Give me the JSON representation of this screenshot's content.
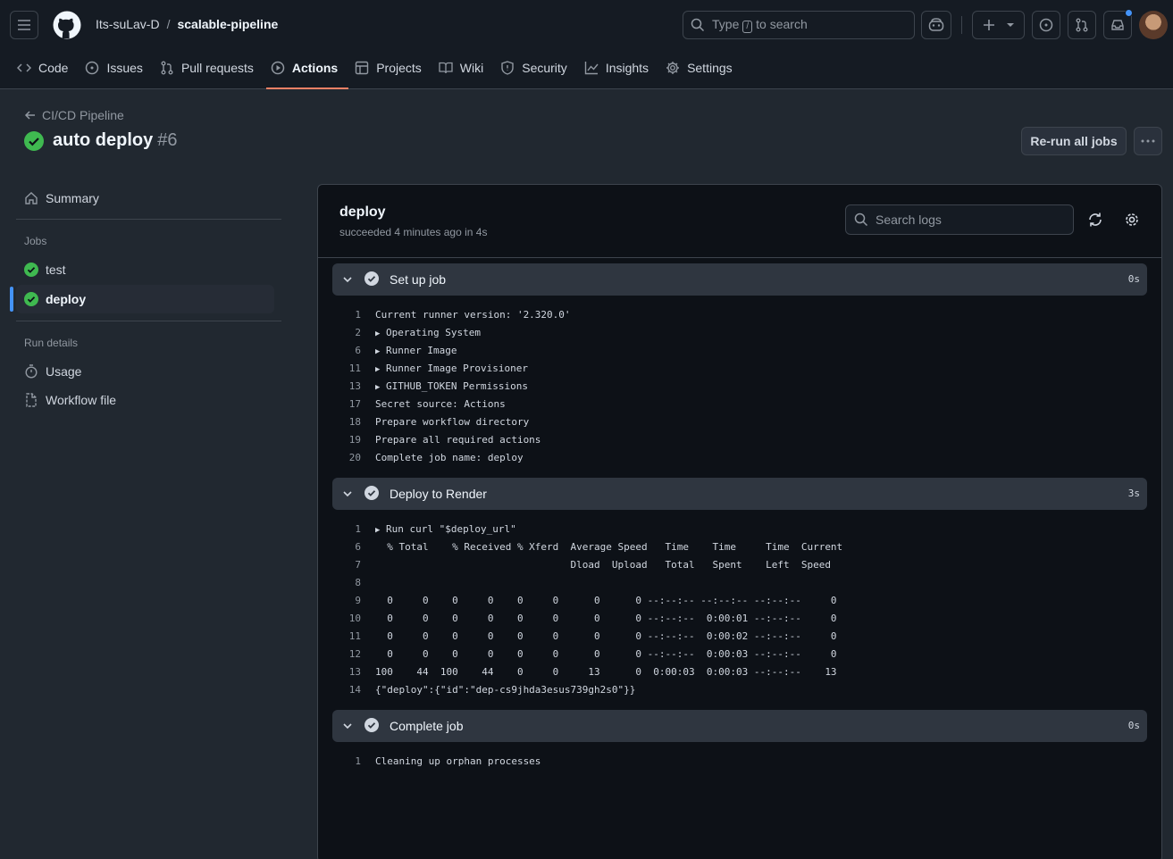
{
  "header": {
    "owner": "Its-suLav-D",
    "separator": "/",
    "repo": "scalable-pipeline",
    "search_prefix": "Type",
    "search_key": "/",
    "search_suffix": "to search"
  },
  "tabs": [
    {
      "label": "Code",
      "icon": "code-icon"
    },
    {
      "label": "Issues",
      "icon": "issue-icon"
    },
    {
      "label": "Pull requests",
      "icon": "pull-request-icon"
    },
    {
      "label": "Actions",
      "icon": "play-icon",
      "active": true
    },
    {
      "label": "Projects",
      "icon": "table-icon"
    },
    {
      "label": "Wiki",
      "icon": "book-icon"
    },
    {
      "label": "Security",
      "icon": "shield-icon"
    },
    {
      "label": "Insights",
      "icon": "graph-icon"
    },
    {
      "label": "Settings",
      "icon": "gear-icon"
    }
  ],
  "run": {
    "back_label": "CI/CD Pipeline",
    "title": "auto deploy",
    "number": "#6",
    "rerun_label": "Re-run all jobs"
  },
  "sidebar": {
    "summary": "Summary",
    "jobs_heading": "Jobs",
    "jobs": [
      {
        "label": "test",
        "status": "success"
      },
      {
        "label": "deploy",
        "status": "success",
        "selected": true
      }
    ],
    "details_heading": "Run details",
    "details": [
      {
        "label": "Usage",
        "icon": "stopwatch-icon"
      },
      {
        "label": "Workflow file",
        "icon": "file-icon"
      }
    ]
  },
  "job": {
    "name": "deploy",
    "meta": "succeeded 4 minutes ago in 4s",
    "search_placeholder": "Search logs"
  },
  "steps": [
    {
      "name": "Set up job",
      "duration": "0s",
      "lines": [
        {
          "n": "1",
          "text": "Current runner version: '2.320.0'"
        },
        {
          "n": "2",
          "text": "Operating System",
          "group": true
        },
        {
          "n": "6",
          "text": "Runner Image",
          "group": true
        },
        {
          "n": "11",
          "text": "Runner Image Provisioner",
          "group": true
        },
        {
          "n": "13",
          "text": "GITHUB_TOKEN Permissions",
          "group": true
        },
        {
          "n": "17",
          "text": "Secret source: Actions"
        },
        {
          "n": "18",
          "text": "Prepare workflow directory"
        },
        {
          "n": "19",
          "text": "Prepare all required actions"
        },
        {
          "n": "20",
          "text": "Complete job name: deploy"
        }
      ]
    },
    {
      "name": "Deploy to Render",
      "duration": "3s",
      "lines": [
        {
          "n": "1",
          "text": "Run curl \"$deploy_url\"",
          "group": true
        },
        {
          "n": "6",
          "text": "  % Total    % Received % Xferd  Average Speed   Time    Time     Time  Current"
        },
        {
          "n": "7",
          "text": "                                 Dload  Upload   Total   Spent    Left  Speed"
        },
        {
          "n": "8",
          "text": ""
        },
        {
          "n": "9",
          "text": "  0     0    0     0    0     0      0      0 --:--:-- --:--:-- --:--:--     0"
        },
        {
          "n": "10",
          "text": "  0     0    0     0    0     0      0      0 --:--:--  0:00:01 --:--:--     0"
        },
        {
          "n": "11",
          "text": "  0     0    0     0    0     0      0      0 --:--:--  0:00:02 --:--:--     0"
        },
        {
          "n": "12",
          "text": "  0     0    0     0    0     0      0      0 --:--:--  0:00:03 --:--:--     0"
        },
        {
          "n": "13",
          "text": "100    44  100    44    0     0     13      0  0:00:03  0:00:03 --:--:--    13"
        },
        {
          "n": "14",
          "text": "{\"deploy\":{\"id\":\"dep-cs9jhda3esus739gh2s0\"}}"
        }
      ]
    },
    {
      "name": "Complete job",
      "duration": "0s",
      "lines": [
        {
          "n": "1",
          "text": "Cleaning up orphan processes"
        }
      ]
    }
  ],
  "colors": {
    "success": "#3fb950",
    "accent_underline": "#f78166",
    "link_blue": "#4493f8"
  }
}
